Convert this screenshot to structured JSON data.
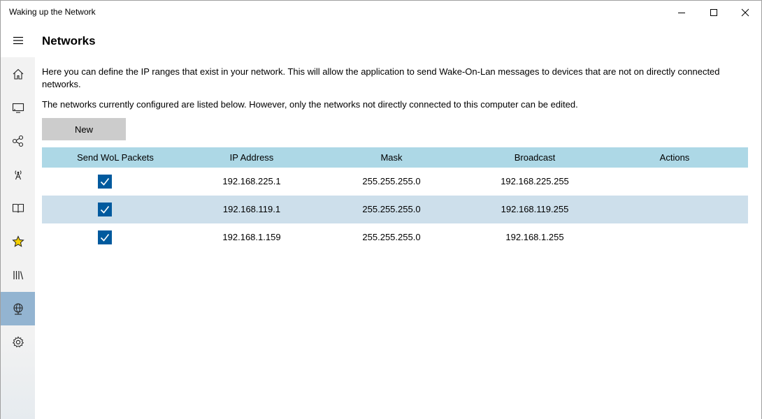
{
  "window": {
    "title": "Waking up the Network",
    "controls": [
      "minimize-icon",
      "maximize-icon",
      "close-icon"
    ]
  },
  "sidebar": {
    "items": [
      {
        "icon": "hamburger-menu-icon"
      },
      {
        "icon": "home-icon"
      },
      {
        "icon": "monitor-icon"
      },
      {
        "icon": "network-nodes-icon"
      },
      {
        "icon": "antenna-icon"
      },
      {
        "icon": "book-icon"
      },
      {
        "icon": "star-icon",
        "color": "#f5d000"
      },
      {
        "icon": "library-icon"
      },
      {
        "icon": "globe-network-icon",
        "selected": true
      },
      {
        "icon": "settings-gear-icon"
      }
    ],
    "selected_color": "#93b4d1"
  },
  "main": {
    "title": "Networks",
    "description1": "Here you can define the IP ranges that exist in your network. This will allow the application to send Wake-On-Lan messages to devices that are not on directly connected networks.",
    "description2": "The networks currently configured are listed below. However, only the networks not directly connected to this computer can be edited.",
    "new_button_label": "New"
  },
  "table": {
    "header_color": "#add8e6",
    "alt_row_color": "#cddfeb",
    "columns": {
      "send_wol": "Send WoL Packets",
      "ip": "IP Address",
      "mask": "Mask",
      "broadcast": "Broadcast",
      "actions": "Actions"
    },
    "rows": [
      {
        "send_wol": true,
        "ip": "192.168.225.1",
        "mask": "255.255.255.0",
        "broadcast": "192.168.225.255",
        "actions": ""
      },
      {
        "send_wol": true,
        "ip": "192.168.119.1",
        "mask": "255.255.255.0",
        "broadcast": "192.168.119.255",
        "actions": ""
      },
      {
        "send_wol": true,
        "ip": "192.168.1.159",
        "mask": "255.255.255.0",
        "broadcast": "192.168.1.255",
        "actions": ""
      }
    ]
  }
}
